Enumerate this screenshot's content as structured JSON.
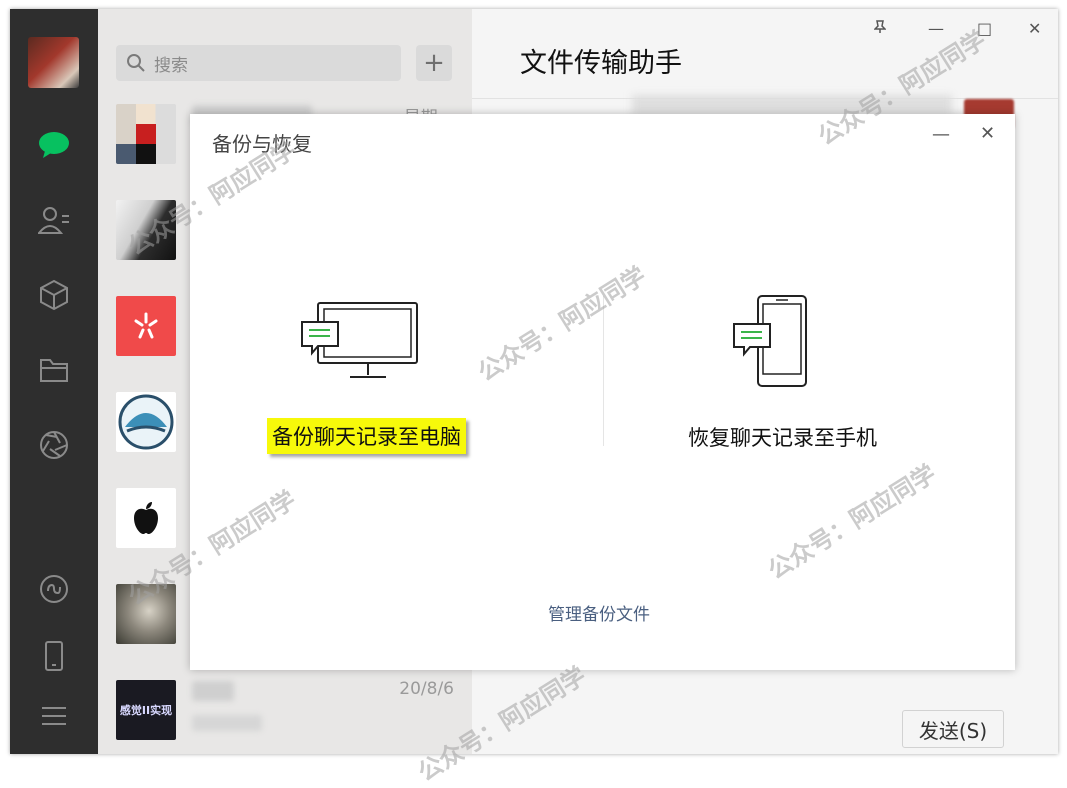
{
  "search": {
    "placeholder": "搜索"
  },
  "chat_list": [
    {
      "time": "星期..."
    },
    {
      "time": ""
    },
    {
      "time": ""
    },
    {
      "time": ""
    },
    {
      "time": ""
    },
    {
      "time": ""
    },
    {
      "time": "20/8/6",
      "thumb_text": "感觉II实现"
    }
  ],
  "chat": {
    "title": "文件传输助手",
    "send_label": "发送(S)"
  },
  "dialog": {
    "title": "备份与恢复",
    "backup_label": "备份聊天记录至电脑",
    "restore_label": "恢复聊天记录至手机",
    "manage_label": "管理备份文件"
  },
  "watermark": {
    "text": "公众号：阿应同学"
  },
  "colors": {
    "accent": "#07c160",
    "highlight": "#f7f90a",
    "rail": "#2e2e2e",
    "link": "#4a5f80"
  }
}
